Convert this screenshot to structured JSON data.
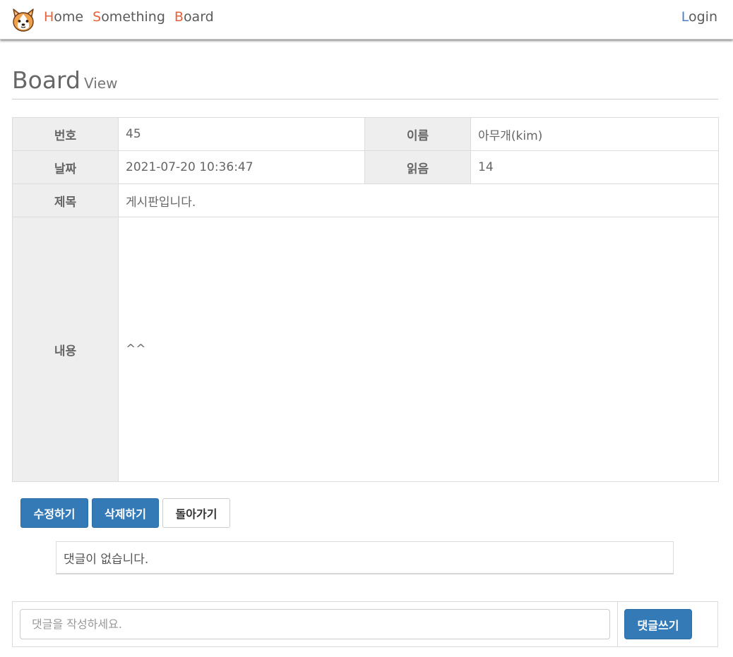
{
  "nav": {
    "logo_icon": "corgi-face-icon",
    "links": [
      {
        "initial": "H",
        "rest": "ome"
      },
      {
        "initial": "S",
        "rest": "omething"
      },
      {
        "initial": "B",
        "rest": "oard"
      }
    ],
    "login": {
      "initial": "L",
      "rest": "ogin"
    },
    "colors": {
      "nav_accent": "#e8633d",
      "login_accent": "#4a7fd0"
    }
  },
  "header": {
    "title": "Board",
    "subtitle": "View"
  },
  "post": {
    "number_label": "번호",
    "number": "45",
    "name_label": "이름",
    "name": "아무개(kim)",
    "date_label": "날짜",
    "date": "2021-07-20 10:36:47",
    "views_label": "읽음",
    "views": "14",
    "subject_label": "제목",
    "subject": "게시판입니다.",
    "content_label": "내용",
    "content": "^^"
  },
  "actions": {
    "edit": "수정하기",
    "delete": "삭제하기",
    "back": "돌아가기"
  },
  "comments": {
    "empty_message": "댓글이 없습니다."
  },
  "comment_form": {
    "placeholder": "댓글을 작성하세요.",
    "value": "",
    "submit": "댓글쓰기"
  },
  "colors": {
    "primary": "#337ab7",
    "header_cell": "#eeeeee"
  }
}
